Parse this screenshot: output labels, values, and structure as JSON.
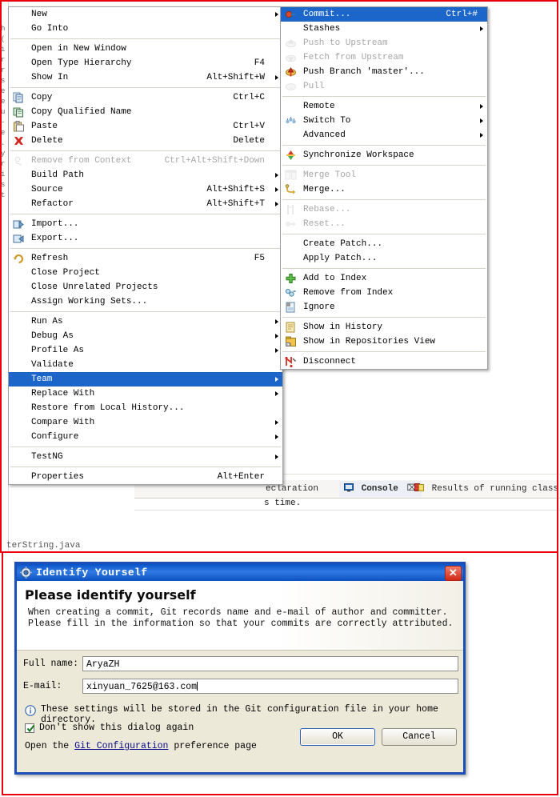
{
  "ide": {
    "file_tab_label": "terString.java",
    "console_output": "s time.",
    "tabs": [
      {
        "label": "eclaration",
        "icon": "declaration-icon",
        "active": false
      },
      {
        "label": "Console",
        "icon": "console-icon",
        "active": true,
        "close": "⌧"
      },
      {
        "label": "Results of running class M",
        "icon": "testng-icon",
        "active": false
      }
    ],
    "left_edge_text": [
      "h",
      "(",
      "i",
      "r",
      "r",
      "s",
      "e",
      "e",
      "u",
      "-",
      "e",
      ".",
      "y",
      "r",
      "i",
      "s",
      "t"
    ]
  },
  "context_menu": {
    "items": [
      {
        "label": "New",
        "accel": "",
        "submenu": true,
        "icon": "",
        "disabled": false
      },
      {
        "label": "Go Into",
        "accel": "",
        "submenu": false,
        "icon": "",
        "disabled": false
      },
      {
        "separator": true
      },
      {
        "label": "Open in New Window",
        "accel": "",
        "submenu": false,
        "icon": "",
        "disabled": false
      },
      {
        "label": "Open Type Hierarchy",
        "accel": "F4",
        "submenu": false,
        "icon": "",
        "disabled": false
      },
      {
        "label": "Show In",
        "accel": "Alt+Shift+W",
        "submenu": true,
        "icon": "",
        "disabled": false
      },
      {
        "separator": true
      },
      {
        "label": "Copy",
        "accel": "Ctrl+C",
        "submenu": false,
        "icon": "copy-icon",
        "disabled": false
      },
      {
        "label": "Copy Qualified Name",
        "accel": "",
        "submenu": false,
        "icon": "copy-qualified-icon",
        "disabled": false
      },
      {
        "label": "Paste",
        "accel": "Ctrl+V",
        "submenu": false,
        "icon": "paste-icon",
        "disabled": false
      },
      {
        "label": "Delete",
        "accel": "Delete",
        "submenu": false,
        "icon": "delete-icon",
        "disabled": false
      },
      {
        "separator": true
      },
      {
        "label": "Remove from Context",
        "accel": "Ctrl+Alt+Shift+Down",
        "submenu": false,
        "icon": "remove-context-icon",
        "disabled": true
      },
      {
        "label": "Build Path",
        "accel": "",
        "submenu": true,
        "icon": "",
        "disabled": false
      },
      {
        "label": "Source",
        "accel": "Alt+Shift+S",
        "submenu": true,
        "icon": "",
        "disabled": false
      },
      {
        "label": "Refactor",
        "accel": "Alt+Shift+T",
        "submenu": true,
        "icon": "",
        "disabled": false
      },
      {
        "separator": true
      },
      {
        "label": "Import...",
        "accel": "",
        "submenu": false,
        "icon": "import-icon",
        "disabled": false
      },
      {
        "label": "Export...",
        "accel": "",
        "submenu": false,
        "icon": "export-icon",
        "disabled": false
      },
      {
        "separator": true
      },
      {
        "label": "Refresh",
        "accel": "F5",
        "submenu": false,
        "icon": "refresh-icon",
        "disabled": false
      },
      {
        "label": "Close Project",
        "accel": "",
        "submenu": false,
        "icon": "",
        "disabled": false
      },
      {
        "label": "Close Unrelated Projects",
        "accel": "",
        "submenu": false,
        "icon": "",
        "disabled": false
      },
      {
        "label": "Assign Working Sets...",
        "accel": "",
        "submenu": false,
        "icon": "",
        "disabled": false
      },
      {
        "separator": true
      },
      {
        "label": "Run As",
        "accel": "",
        "submenu": true,
        "icon": "",
        "disabled": false
      },
      {
        "label": "Debug As",
        "accel": "",
        "submenu": true,
        "icon": "",
        "disabled": false
      },
      {
        "label": "Profile As",
        "accel": "",
        "submenu": true,
        "icon": "",
        "disabled": false
      },
      {
        "label": "Validate",
        "accel": "",
        "submenu": false,
        "icon": "",
        "disabled": false
      },
      {
        "label": "Team",
        "accel": "",
        "submenu": true,
        "icon": "",
        "disabled": false,
        "selected": true
      },
      {
        "label": "Replace With",
        "accel": "",
        "submenu": true,
        "icon": "",
        "disabled": false
      },
      {
        "label": "Restore from Local History...",
        "accel": "",
        "submenu": false,
        "icon": "",
        "disabled": false
      },
      {
        "label": "Compare With",
        "accel": "",
        "submenu": true,
        "icon": "",
        "disabled": false
      },
      {
        "label": "Configure",
        "accel": "",
        "submenu": true,
        "icon": "",
        "disabled": false
      },
      {
        "separator": true
      },
      {
        "label": "TestNG",
        "accel": "",
        "submenu": true,
        "icon": "",
        "disabled": false
      },
      {
        "separator": true
      },
      {
        "label": "Properties",
        "accel": "Alt+Enter",
        "submenu": false,
        "icon": "",
        "disabled": false
      }
    ]
  },
  "team_submenu": {
    "items": [
      {
        "label": "Commit...",
        "accel": "Ctrl+#",
        "submenu": false,
        "icon": "commit-icon",
        "disabled": false,
        "selected": true
      },
      {
        "label": "Stashes",
        "accel": "",
        "submenu": true,
        "icon": "",
        "disabled": false
      },
      {
        "label": "Push to Upstream",
        "accel": "",
        "submenu": false,
        "icon": "push-icon",
        "disabled": true
      },
      {
        "label": "Fetch from Upstream",
        "accel": "",
        "submenu": false,
        "icon": "fetch-icon",
        "disabled": true
      },
      {
        "label": "Push Branch 'master'...",
        "accel": "",
        "submenu": false,
        "icon": "push-branch-icon",
        "disabled": false
      },
      {
        "label": "Pull",
        "accel": "",
        "submenu": false,
        "icon": "pull-icon",
        "disabled": true
      },
      {
        "separator": true
      },
      {
        "label": "Remote",
        "accel": "",
        "submenu": true,
        "icon": "",
        "disabled": false
      },
      {
        "label": "Switch To",
        "accel": "",
        "submenu": true,
        "icon": "switch-to-icon",
        "disabled": false
      },
      {
        "label": "Advanced",
        "accel": "",
        "submenu": true,
        "icon": "",
        "disabled": false
      },
      {
        "separator": true
      },
      {
        "label": "Synchronize Workspace",
        "accel": "",
        "submenu": false,
        "icon": "synchronize-icon",
        "disabled": false
      },
      {
        "separator": true
      },
      {
        "label": "Merge Tool",
        "accel": "",
        "submenu": false,
        "icon": "merge-tool-icon",
        "disabled": true
      },
      {
        "label": "Merge...",
        "accel": "",
        "submenu": false,
        "icon": "merge-icon",
        "disabled": false
      },
      {
        "separator": true
      },
      {
        "label": "Rebase...",
        "accel": "",
        "submenu": false,
        "icon": "rebase-icon",
        "disabled": true
      },
      {
        "label": "Reset...",
        "accel": "",
        "submenu": false,
        "icon": "reset-icon",
        "disabled": true
      },
      {
        "separator": true
      },
      {
        "label": "Create Patch...",
        "accel": "",
        "submenu": false,
        "icon": "",
        "disabled": false
      },
      {
        "label": "Apply Patch...",
        "accel": "",
        "submenu": false,
        "icon": "",
        "disabled": false
      },
      {
        "separator": true
      },
      {
        "label": "Add to Index",
        "accel": "",
        "submenu": false,
        "icon": "add-index-icon",
        "disabled": false
      },
      {
        "label": "Remove from Index",
        "accel": "",
        "submenu": false,
        "icon": "remove-index-icon",
        "disabled": false
      },
      {
        "label": "Ignore",
        "accel": "",
        "submenu": false,
        "icon": "ignore-icon",
        "disabled": false
      },
      {
        "separator": true
      },
      {
        "label": "Show in History",
        "accel": "",
        "submenu": false,
        "icon": "history-icon",
        "disabled": false
      },
      {
        "label": "Show in Repositories View",
        "accel": "",
        "submenu": false,
        "icon": "repositories-icon",
        "disabled": false
      },
      {
        "separator": true
      },
      {
        "label": "Disconnect",
        "accel": "",
        "submenu": false,
        "icon": "disconnect-icon",
        "disabled": false
      }
    ]
  },
  "dialog": {
    "title": "Identify Yourself",
    "heading": "Please identify yourself",
    "description": "When creating a commit, Git records name and e-mail of author and committer. Please fill in the information so that your commits are correctly attributed.",
    "fields": [
      {
        "label": "Full name:",
        "value": "AryaZH",
        "placeholder": ""
      },
      {
        "label": "E-mail:",
        "value": "xinyuan_7625@163.com",
        "placeholder": ""
      }
    ],
    "note": "These settings will be stored in the Git configuration file in your home directory.",
    "checkbox": {
      "label": "Don't show this dialog again",
      "checked": true
    },
    "link_row": {
      "prefix": "Open the ",
      "link": "Git Configuration",
      "suffix": " preference page"
    },
    "buttons": [
      {
        "id": "ok",
        "label": "OK",
        "default": true
      },
      {
        "id": "cancel",
        "label": "Cancel",
        "default": false
      }
    ],
    "close_glyph": "✕"
  },
  "colors": {
    "menu_highlight": "#1d66c9",
    "annotation_red": "#e8000a",
    "dialog_titlebar": "#0a53c8",
    "link": "#0a0a8c"
  }
}
